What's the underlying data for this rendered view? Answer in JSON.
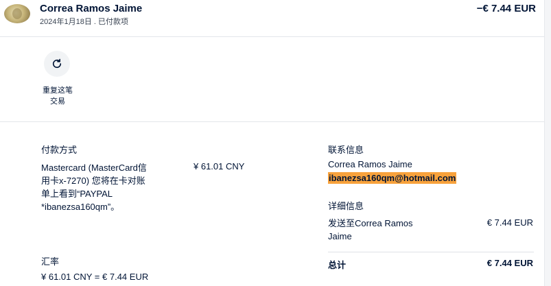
{
  "header": {
    "merchant": "Correa Ramos Jaime",
    "subline": "2024年1月18日 . 已付款项",
    "amount": "−€ 7.44 EUR"
  },
  "actions": {
    "repeat_label": "重复这笔交易"
  },
  "payment_method": {
    "title": "付款方式",
    "text": "Mastercard (MasterCard信用卡x-7270) 您将在卡对账单上看到“PAYPAL *ibanezsa160qm”。",
    "amount": "¥ 61.01 CNY"
  },
  "exchange_rate": {
    "title": "汇率",
    "value": "¥ 61.01 CNY = € 7.44 EUR"
  },
  "contact": {
    "title": "联系信息",
    "name": "Correa Ramos Jaime",
    "email": "ibanezsa160qm@hotmail.com"
  },
  "details": {
    "title": "详细信息",
    "text": "发送至Correa Ramos Jaime",
    "amount": "€ 7.44 EUR"
  },
  "total": {
    "label": "总计",
    "amount": "€ 7.44 EUR"
  },
  "colors": {
    "text": "#001435",
    "email_highlight": "#f8a23c",
    "button_bg": "#f1f3f5"
  }
}
